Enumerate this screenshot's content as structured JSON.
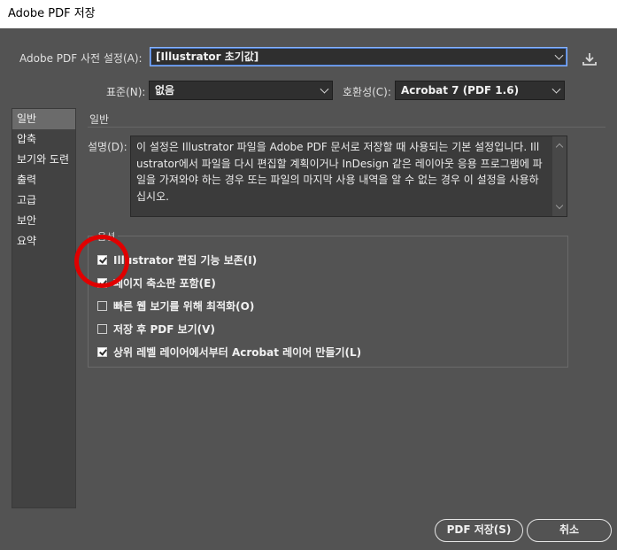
{
  "window": {
    "title": "Adobe PDF 저장"
  },
  "preset": {
    "label": "Adobe PDF 사전 설정(A):",
    "value": "[Illustrator 초기값]"
  },
  "standard": {
    "label": "표준(N):",
    "value": "없음"
  },
  "compat": {
    "label": "호환성(C):",
    "value": "Acrobat 7 (PDF 1.6)"
  },
  "sidebar": {
    "items": [
      {
        "label": "일반"
      },
      {
        "label": "압축"
      },
      {
        "label": "보기와 도련"
      },
      {
        "label": "출력"
      },
      {
        "label": "고급"
      },
      {
        "label": "보안"
      },
      {
        "label": "요약"
      }
    ]
  },
  "general": {
    "section_title": "일반",
    "description_label": "설명(D):",
    "description": "이 설정은 Illustrator 파일을 Adobe PDF 문서로 저장할 때 사용되는 기본 설정입니다. Illustrator에서 파일을 다시 편집할 계획이거나 InDesign 같은 레이아웃 응용 프로그램에 파일을 가져와야 하는 경우 또는 파일의 마지막 사용 내역을 알 수 없는 경우 이 설정을 사용하십시오.",
    "options_title": "옵션",
    "options": [
      {
        "label": "Illustrator 편집 기능 보존(I)",
        "checked": true
      },
      {
        "label": "페이지 축소판 포함(E)",
        "checked": true
      },
      {
        "label": "빠른 웹 보기를 위해 최적화(O)",
        "checked": false
      },
      {
        "label": "저장 후 PDF 보기(V)",
        "checked": false
      },
      {
        "label": "상위 레벨 레이어에서부터 Acrobat 레이어 만들기(L)",
        "checked": true
      }
    ]
  },
  "buttons": {
    "save": "PDF 저장(S)",
    "cancel": "취소"
  }
}
